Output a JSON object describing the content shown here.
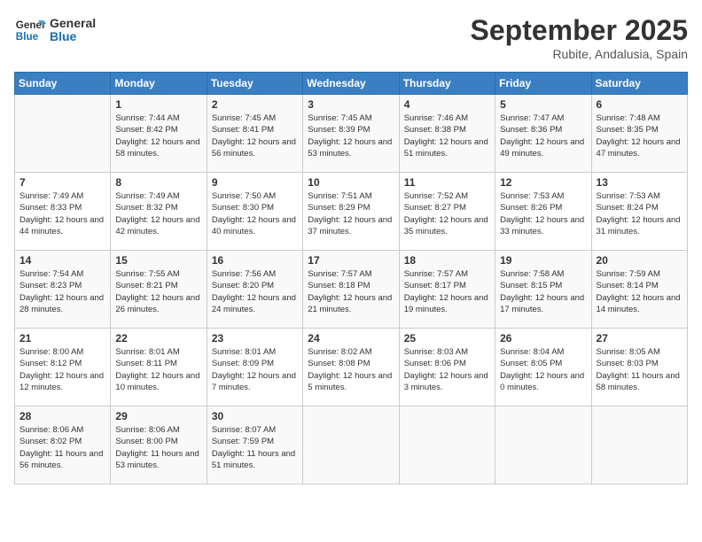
{
  "header": {
    "logo_line1": "General",
    "logo_line2": "Blue",
    "month": "September 2025",
    "location": "Rubite, Andalusia, Spain"
  },
  "weekdays": [
    "Sunday",
    "Monday",
    "Tuesday",
    "Wednesday",
    "Thursday",
    "Friday",
    "Saturday"
  ],
  "weeks": [
    [
      {
        "day": "",
        "text": ""
      },
      {
        "day": "1",
        "text": "Sunrise: 7:44 AM\nSunset: 8:42 PM\nDaylight: 12 hours and 58 minutes."
      },
      {
        "day": "2",
        "text": "Sunrise: 7:45 AM\nSunset: 8:41 PM\nDaylight: 12 hours and 56 minutes."
      },
      {
        "day": "3",
        "text": "Sunrise: 7:45 AM\nSunset: 8:39 PM\nDaylight: 12 hours and 53 minutes."
      },
      {
        "day": "4",
        "text": "Sunrise: 7:46 AM\nSunset: 8:38 PM\nDaylight: 12 hours and 51 minutes."
      },
      {
        "day": "5",
        "text": "Sunrise: 7:47 AM\nSunset: 8:36 PM\nDaylight: 12 hours and 49 minutes."
      },
      {
        "day": "6",
        "text": "Sunrise: 7:48 AM\nSunset: 8:35 PM\nDaylight: 12 hours and 47 minutes."
      }
    ],
    [
      {
        "day": "7",
        "text": "Sunrise: 7:49 AM\nSunset: 8:33 PM\nDaylight: 12 hours and 44 minutes."
      },
      {
        "day": "8",
        "text": "Sunrise: 7:49 AM\nSunset: 8:32 PM\nDaylight: 12 hours and 42 minutes."
      },
      {
        "day": "9",
        "text": "Sunrise: 7:50 AM\nSunset: 8:30 PM\nDaylight: 12 hours and 40 minutes."
      },
      {
        "day": "10",
        "text": "Sunrise: 7:51 AM\nSunset: 8:29 PM\nDaylight: 12 hours and 37 minutes."
      },
      {
        "day": "11",
        "text": "Sunrise: 7:52 AM\nSunset: 8:27 PM\nDaylight: 12 hours and 35 minutes."
      },
      {
        "day": "12",
        "text": "Sunrise: 7:53 AM\nSunset: 8:26 PM\nDaylight: 12 hours and 33 minutes."
      },
      {
        "day": "13",
        "text": "Sunrise: 7:53 AM\nSunset: 8:24 PM\nDaylight: 12 hours and 31 minutes."
      }
    ],
    [
      {
        "day": "14",
        "text": "Sunrise: 7:54 AM\nSunset: 8:23 PM\nDaylight: 12 hours and 28 minutes."
      },
      {
        "day": "15",
        "text": "Sunrise: 7:55 AM\nSunset: 8:21 PM\nDaylight: 12 hours and 26 minutes."
      },
      {
        "day": "16",
        "text": "Sunrise: 7:56 AM\nSunset: 8:20 PM\nDaylight: 12 hours and 24 minutes."
      },
      {
        "day": "17",
        "text": "Sunrise: 7:57 AM\nSunset: 8:18 PM\nDaylight: 12 hours and 21 minutes."
      },
      {
        "day": "18",
        "text": "Sunrise: 7:57 AM\nSunset: 8:17 PM\nDaylight: 12 hours and 19 minutes."
      },
      {
        "day": "19",
        "text": "Sunrise: 7:58 AM\nSunset: 8:15 PM\nDaylight: 12 hours and 17 minutes."
      },
      {
        "day": "20",
        "text": "Sunrise: 7:59 AM\nSunset: 8:14 PM\nDaylight: 12 hours and 14 minutes."
      }
    ],
    [
      {
        "day": "21",
        "text": "Sunrise: 8:00 AM\nSunset: 8:12 PM\nDaylight: 12 hours and 12 minutes."
      },
      {
        "day": "22",
        "text": "Sunrise: 8:01 AM\nSunset: 8:11 PM\nDaylight: 12 hours and 10 minutes."
      },
      {
        "day": "23",
        "text": "Sunrise: 8:01 AM\nSunset: 8:09 PM\nDaylight: 12 hours and 7 minutes."
      },
      {
        "day": "24",
        "text": "Sunrise: 8:02 AM\nSunset: 8:08 PM\nDaylight: 12 hours and 5 minutes."
      },
      {
        "day": "25",
        "text": "Sunrise: 8:03 AM\nSunset: 8:06 PM\nDaylight: 12 hours and 3 minutes."
      },
      {
        "day": "26",
        "text": "Sunrise: 8:04 AM\nSunset: 8:05 PM\nDaylight: 12 hours and 0 minutes."
      },
      {
        "day": "27",
        "text": "Sunrise: 8:05 AM\nSunset: 8:03 PM\nDaylight: 11 hours and 58 minutes."
      }
    ],
    [
      {
        "day": "28",
        "text": "Sunrise: 8:06 AM\nSunset: 8:02 PM\nDaylight: 11 hours and 56 minutes."
      },
      {
        "day": "29",
        "text": "Sunrise: 8:06 AM\nSunset: 8:00 PM\nDaylight: 11 hours and 53 minutes."
      },
      {
        "day": "30",
        "text": "Sunrise: 8:07 AM\nSunset: 7:59 PM\nDaylight: 11 hours and 51 minutes."
      },
      {
        "day": "",
        "text": ""
      },
      {
        "day": "",
        "text": ""
      },
      {
        "day": "",
        "text": ""
      },
      {
        "day": "",
        "text": ""
      }
    ]
  ]
}
